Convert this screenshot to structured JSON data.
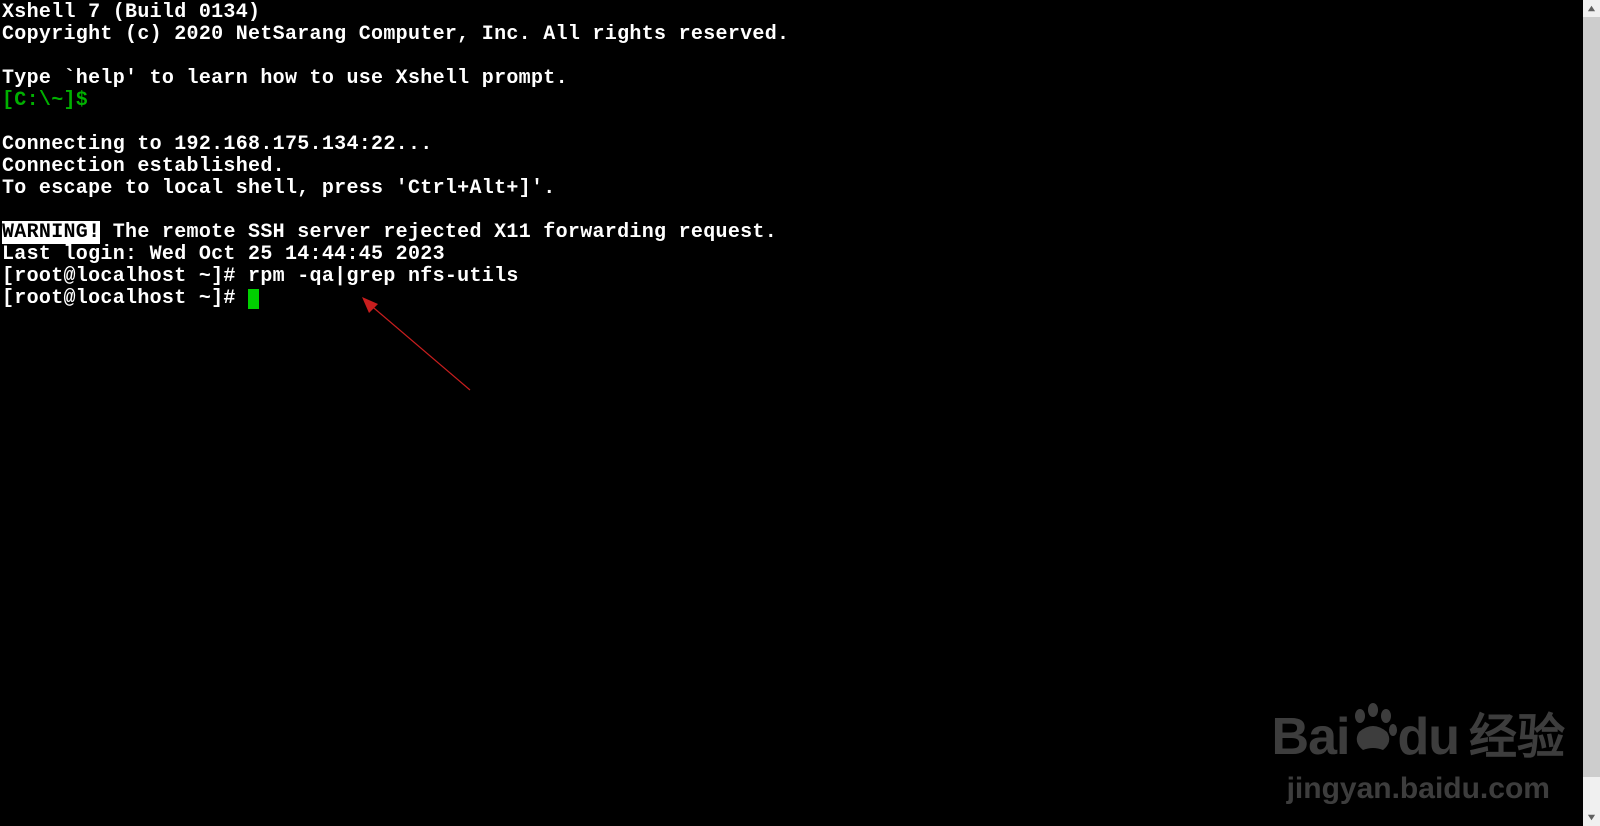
{
  "header": {
    "title": "Xshell 7 (Build 0134)",
    "copyright": "Copyright (c) 2020 NetSarang Computer, Inc. All rights reserved."
  },
  "intro": {
    "help_hint": "Type `help' to learn how to use Xshell prompt.",
    "local_prompt": "[C:\\~]$ "
  },
  "connection": {
    "connecting": "Connecting to 192.168.175.134:22...",
    "established": "Connection established.",
    "escape_hint": "To escape to local shell, press 'Ctrl+Alt+]'."
  },
  "warning": {
    "label": "WARNING!",
    "message": " The remote SSH server rejected X11 forwarding request."
  },
  "session": {
    "last_login": "Last login: Wed Oct 25 14:44:45 2023",
    "prompt1": "[root@localhost ~]# ",
    "command1": "rpm -qa|grep nfs-utils",
    "prompt2": "[root@localhost ~]# "
  },
  "watermark": {
    "brand": "Bai",
    "brand2": "du",
    "cn": "经验",
    "url": "jingyan.baidu.com"
  }
}
